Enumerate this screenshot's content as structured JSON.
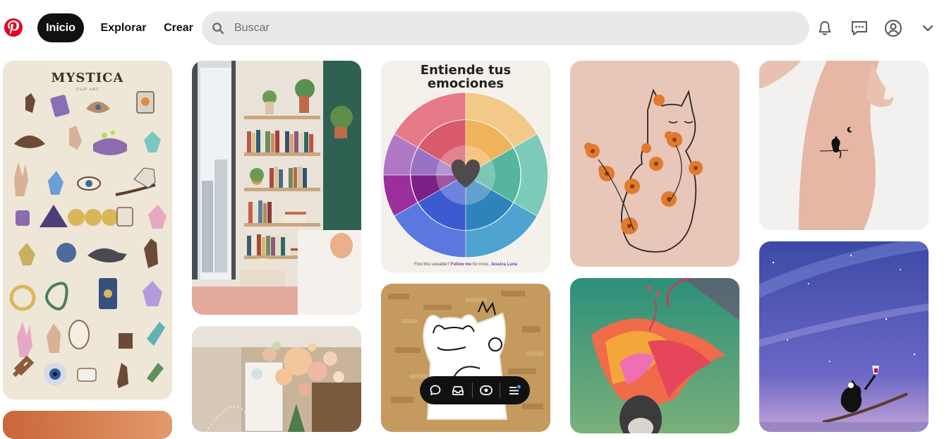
{
  "header": {
    "logo_icon": "pinterest-logo-icon",
    "nav": {
      "home_label": "Inicio",
      "explore_label": "Explorar",
      "create_label": "Crear"
    },
    "search": {
      "placeholder": "Buscar",
      "icon": "search-icon"
    },
    "icons": [
      "bell-icon",
      "messages-icon",
      "profile-icon",
      "chevron-down-icon"
    ]
  },
  "pins": {
    "mystica": {
      "title": "MYSTICA",
      "subtitle": "CLIP ART"
    },
    "emotions": {
      "title_line1": "Entiende tus",
      "title_line2": "emociones",
      "footer_prefix": "Find this valuable?",
      "footer_follow": "Follow me",
      "footer_mid": "for more.",
      "footer_author": "Jessica Luna"
    }
  },
  "toolbar": {
    "icons": [
      "comment-icon",
      "save-board-icon",
      "visual-search-icon",
      "menu-icon"
    ]
  },
  "colors": {
    "brand": "#e60023",
    "active_nav": "#111111",
    "search_bg": "#e9e9e9"
  }
}
